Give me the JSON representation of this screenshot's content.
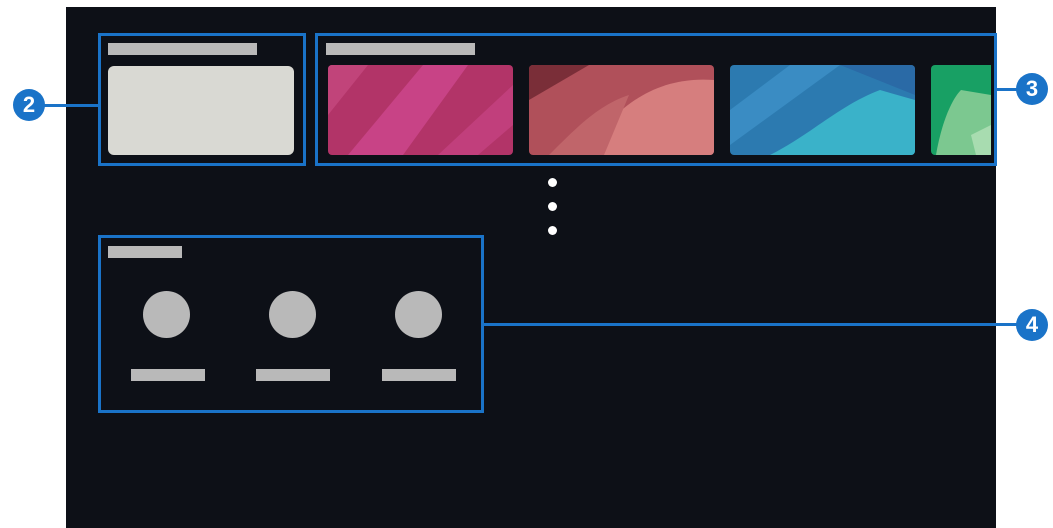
{
  "colors": {
    "screen_bg": "#0d1017",
    "highlight": "#1a73c8",
    "placeholder": "#b9b9b9",
    "featured_card": "#d9d9d3",
    "outside": "#ffffff"
  },
  "callouts": {
    "left_marker": "2",
    "right_top_marker": "3",
    "right_bottom_marker": "4"
  },
  "featured_section": {
    "card_icon": "featured-tile"
  },
  "media_row": {
    "tiles": [
      {
        "theme": "magenta",
        "base": "#b23468",
        "accent": "#c84386"
      },
      {
        "theme": "coral",
        "base": "#b0505a",
        "accent": "#d67e7e"
      },
      {
        "theme": "blue",
        "base": "#2c7ab0",
        "accent": "#3ab2c9"
      },
      {
        "theme": "green",
        "base": "#18a064",
        "accent": "#7cc890"
      }
    ]
  },
  "more_indicator": {
    "icon": "vertical-ellipsis-icon"
  },
  "apps_section": {
    "item_count": 3,
    "item_icon": "app-circle-icon"
  }
}
